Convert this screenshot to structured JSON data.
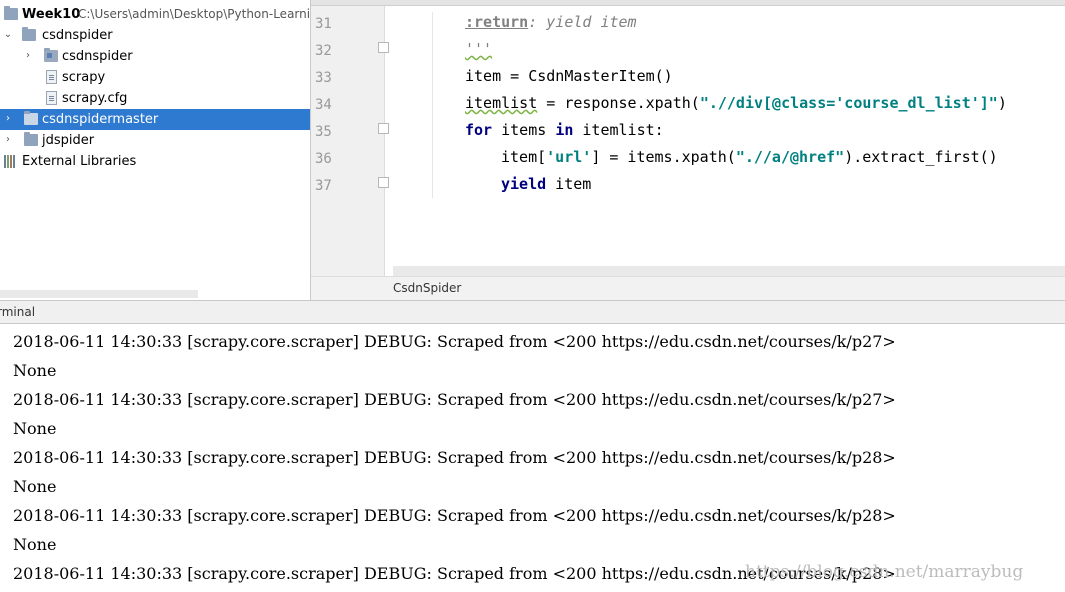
{
  "project_tree": {
    "root_name": "Week10",
    "root_path": "C:\\Users\\admin\\Desktop\\Python-Learnin",
    "items": [
      {
        "label": "csdnspider"
      },
      {
        "label": "csdnspider"
      },
      {
        "label": "scrapy"
      },
      {
        "label": "scrapy.cfg"
      },
      {
        "label": "csdnspidermaster"
      },
      {
        "label": "jdspider"
      },
      {
        "label": "External Libraries"
      }
    ]
  },
  "editor": {
    "line_numbers": [
      "31",
      "32",
      "33",
      "34",
      "35",
      "36",
      "37"
    ],
    "lines": {
      "l31_tag": ":return",
      "l31_rest": ": yield item",
      "l32": "'''",
      "l33": "item = CsdnMasterItem()",
      "l34_a": "itemlist",
      "l34_b": " = response.xpath(",
      "l34_str": "\".//div[@class='course_dl_list']\"",
      "l34_c": ")",
      "l35_kw1": "for",
      "l35_a": " items ",
      "l35_kw2": "in",
      "l35_b": " itemlist:",
      "l36_a": "item[",
      "l36_str1": "'url'",
      "l36_b": "] = items.xpath(",
      "l36_str2": "\".//a/@href\"",
      "l36_c": ").extract_first()",
      "l37_kw": "yield",
      "l37_a": " item"
    },
    "breadcrumb": "CsdnSpider"
  },
  "terminal": {
    "title": "rminal",
    "lines": [
      "2018-06-11 14:30:33 [scrapy.core.scraper] DEBUG: Scraped from <200 https://edu.csdn.net/courses/k/p27>",
      "None",
      "2018-06-11 14:30:33 [scrapy.core.scraper] DEBUG: Scraped from <200 https://edu.csdn.net/courses/k/p27>",
      "None",
      "2018-06-11 14:30:33 [scrapy.core.scraper] DEBUG: Scraped from <200 https://edu.csdn.net/courses/k/p28>",
      "None",
      "2018-06-11 14:30:33 [scrapy.core.scraper] DEBUG: Scraped from <200 https://edu.csdn.net/courses/k/p28>",
      "None",
      "2018-06-11 14:30:33 [scrapy.core.scraper] DEBUG: Scraped from <200 https://edu.csdn.net/courses/k/p28>"
    ],
    "watermark": "https://blog.csdn.net/marraybug"
  },
  "colors": {
    "selection": "#2f7ad1",
    "keyword": "#000080",
    "string": "#008080",
    "comment": "#808080"
  }
}
